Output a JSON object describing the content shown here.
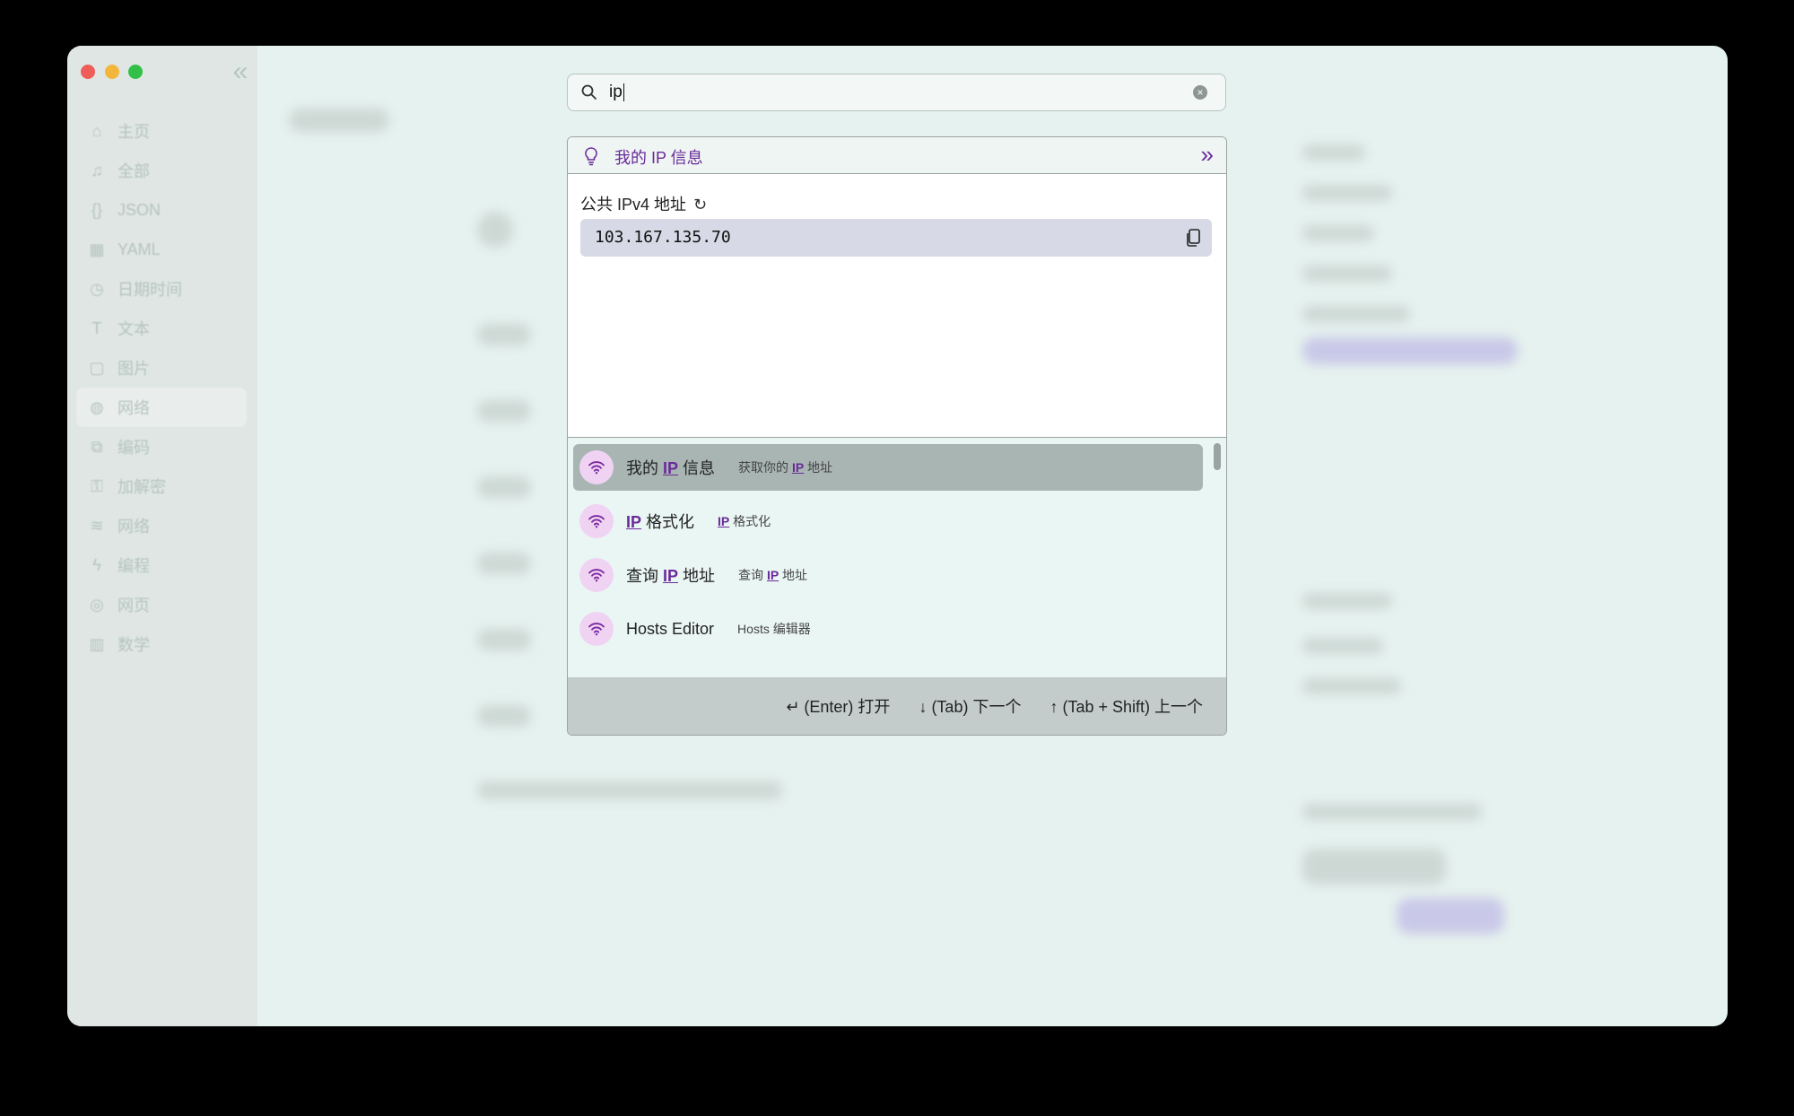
{
  "sidebar": {
    "items": [
      {
        "icon": "home-icon",
        "label": "主页"
      },
      {
        "icon": "bell-icon",
        "label": "全部"
      },
      {
        "icon": "braces-icon",
        "label": "JSON"
      },
      {
        "icon": "grid-icon",
        "label": "YAML"
      },
      {
        "icon": "clock-icon",
        "label": "日期时间"
      },
      {
        "icon": "text-icon",
        "label": "文本"
      },
      {
        "icon": "image-icon",
        "label": "图片"
      },
      {
        "icon": "network-icon",
        "label": "网络"
      },
      {
        "icon": "code-icon",
        "label": "编码"
      },
      {
        "icon": "lock-icon",
        "label": "加解密"
      },
      {
        "icon": "wifi-icon",
        "label": "网络"
      },
      {
        "icon": "bolt-icon",
        "label": "编程"
      },
      {
        "icon": "globe-icon",
        "label": "网页"
      },
      {
        "icon": "chart-icon",
        "label": "数学"
      }
    ]
  },
  "search": {
    "value": "ip"
  },
  "panel": {
    "title": "我的 IP 信息",
    "ipv4_label": "公共 IPv4 地址",
    "ip_value": "103.167.135.70"
  },
  "results": [
    {
      "name_parts": [
        "我的 ",
        "IP",
        " 信息"
      ],
      "desc_parts": [
        "获取你的 ",
        "IP",
        " 地址"
      ],
      "selected": true
    },
    {
      "name_parts": [
        "",
        "IP",
        " 格式化"
      ],
      "desc_parts": [
        "",
        "IP",
        " 格式化"
      ],
      "selected": false
    },
    {
      "name_parts": [
        "查询 ",
        "IP",
        " 地址"
      ],
      "desc_parts": [
        "查询 ",
        "IP",
        " 地址"
      ],
      "selected": false
    },
    {
      "name_parts": [
        "Hosts Editor",
        "",
        ""
      ],
      "desc_parts": [
        "Hosts 编辑器",
        "",
        ""
      ],
      "selected": false
    }
  ],
  "footer": {
    "enter": "↵ (Enter) 打开",
    "tab": "↓ (Tab) 下一个",
    "shift_tab": "↑ (Tab + Shift) 上一个"
  },
  "colors": {
    "accent": "#6a2a9a",
    "icon_bg": "#f0d3f2",
    "selected_row": "#a8b5b2",
    "ip_box": "#d7d9e6"
  }
}
